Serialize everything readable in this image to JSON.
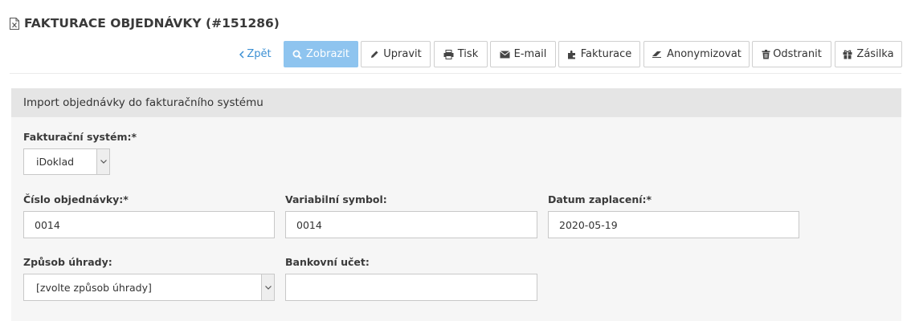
{
  "page": {
    "title": "FAKTURACE OBJEDNÁVKY (#151286)",
    "title_icon": "document-icon"
  },
  "toolbar": {
    "back": {
      "label": "Zpět",
      "icon": "chevron-left-icon"
    },
    "view": {
      "label": "Zobrazit",
      "icon": "search-icon",
      "active": true
    },
    "edit": {
      "label": "Upravit",
      "icon": "pencil-icon"
    },
    "print": {
      "label": "Tisk",
      "icon": "printer-icon"
    },
    "email": {
      "label": "E-mail",
      "icon": "envelope-icon"
    },
    "invoice": {
      "label": "Fakturace",
      "icon": "puzzle-icon"
    },
    "anonymize": {
      "label": "Anonymizovat",
      "icon": "eraser-icon"
    },
    "delete": {
      "label": "Odstranit",
      "icon": "trash-icon"
    },
    "shipment": {
      "label": "Zásilka",
      "icon": "gift-icon"
    }
  },
  "form": {
    "heading": "Import objednávky do fakturačního systému",
    "billing_system": {
      "label": "Fakturační systém:*",
      "value": "iDoklad"
    },
    "order_number": {
      "label": "Číslo objednávky:*",
      "value": "0014"
    },
    "variable_symbol": {
      "label": "Variabilní symbol:",
      "value": "0014"
    },
    "payment_date": {
      "label": "Datum zaplacení:*",
      "value": "2020-05-19"
    },
    "payment_method": {
      "label": "Způsob úhrady:",
      "value": "[zvolte způsob úhrady]"
    },
    "bank_account": {
      "label": "Bankovní učet:",
      "value": ""
    }
  },
  "colors": {
    "accent": "#3b8fd3",
    "active_button": "#8ec4ef",
    "panel_header": "#e5e5e5",
    "panel_body": "#f6f6f6"
  }
}
